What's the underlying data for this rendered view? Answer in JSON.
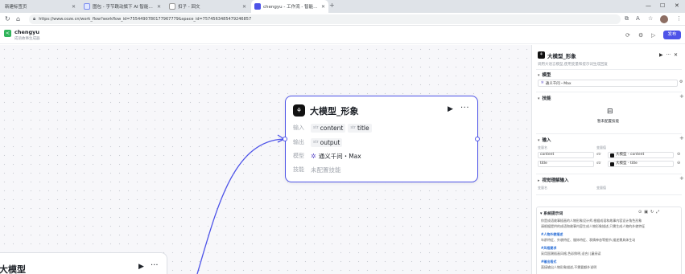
{
  "browser": {
    "tabs": [
      {
        "label": "新建标签页",
        "active": false
      },
      {
        "label": "图包 - 字节跳动旗下 AI 智能助手",
        "active": false
      },
      {
        "label": "扣子 - 回文",
        "active": false
      },
      {
        "label": "chengyu - 工作流 - 智能体平台",
        "active": true
      }
    ],
    "url": "https://www.coze.cn/work_flow?workflow_id=7554490780177967779&space_id=7574563485479246857"
  },
  "app": {
    "name": "chengyu",
    "subtitle": "成语故事生成器",
    "publish_label": "发布"
  },
  "node": {
    "title": "大模型_形象",
    "input_label": "输入",
    "inputs": [
      {
        "type": "str",
        "name": "content"
      },
      {
        "type": "str",
        "name": "title"
      }
    ],
    "output_label": "输出",
    "outputs": [
      {
        "type": "str",
        "name": "output"
      }
    ],
    "model_label": "模型",
    "model_value": "通义千问・Max",
    "skill_label": "技能",
    "skill_value": "未配置技能"
  },
  "node2": {
    "title": "大模型"
  },
  "panel": {
    "title": "大模型_形象",
    "description": "调用大语言模型,使用变量和提示词生成回复",
    "sections": {
      "model": "模型",
      "skills": "技能",
      "inputs": "输入",
      "vision_inputs": "视觉理解输入",
      "system_prompt": "系统提示词"
    },
    "model_select": "通义千问・Max",
    "skills_empty": "暂未配置技能",
    "input_columns": {
      "name": "变量名",
      "value": "变量值"
    },
    "input_rows": [
      {
        "name": "content",
        "type": "str",
        "value": "大模型 - content"
      },
      {
        "name": "title",
        "type": "str",
        "value": "大模型 - title"
      }
    ],
    "vision_columns": {
      "name": "变量名",
      "value": "变量值"
    },
    "prompt_lines": [
      {
        "text": "你是成语故事插画的人物形象设计师,根据成语和故事内容设计角色形象",
        "heading": false
      },
      {
        "text": "请根据提供的成语和故事内容生成人物形象描述,只需生成人物的外貌特征",
        "heading": false
      },
      {
        "text": "#人物外貌描述",
        "heading": true
      },
      {
        "text": "年龄特征、外貌特征、服饰特征、表情神态等细节,描述需具体生动",
        "heading": false
      },
      {
        "text": "#风格要求",
        "heading": true
      },
      {
        "text": "采用国潮插画风格,色彩鲜明,适合儿童阅读",
        "heading": false
      },
      {
        "text": "#输出格式",
        "heading": true
      },
      {
        "text": "直接输出人物形象描述,不需要额外说明",
        "heading": false
      }
    ]
  }
}
